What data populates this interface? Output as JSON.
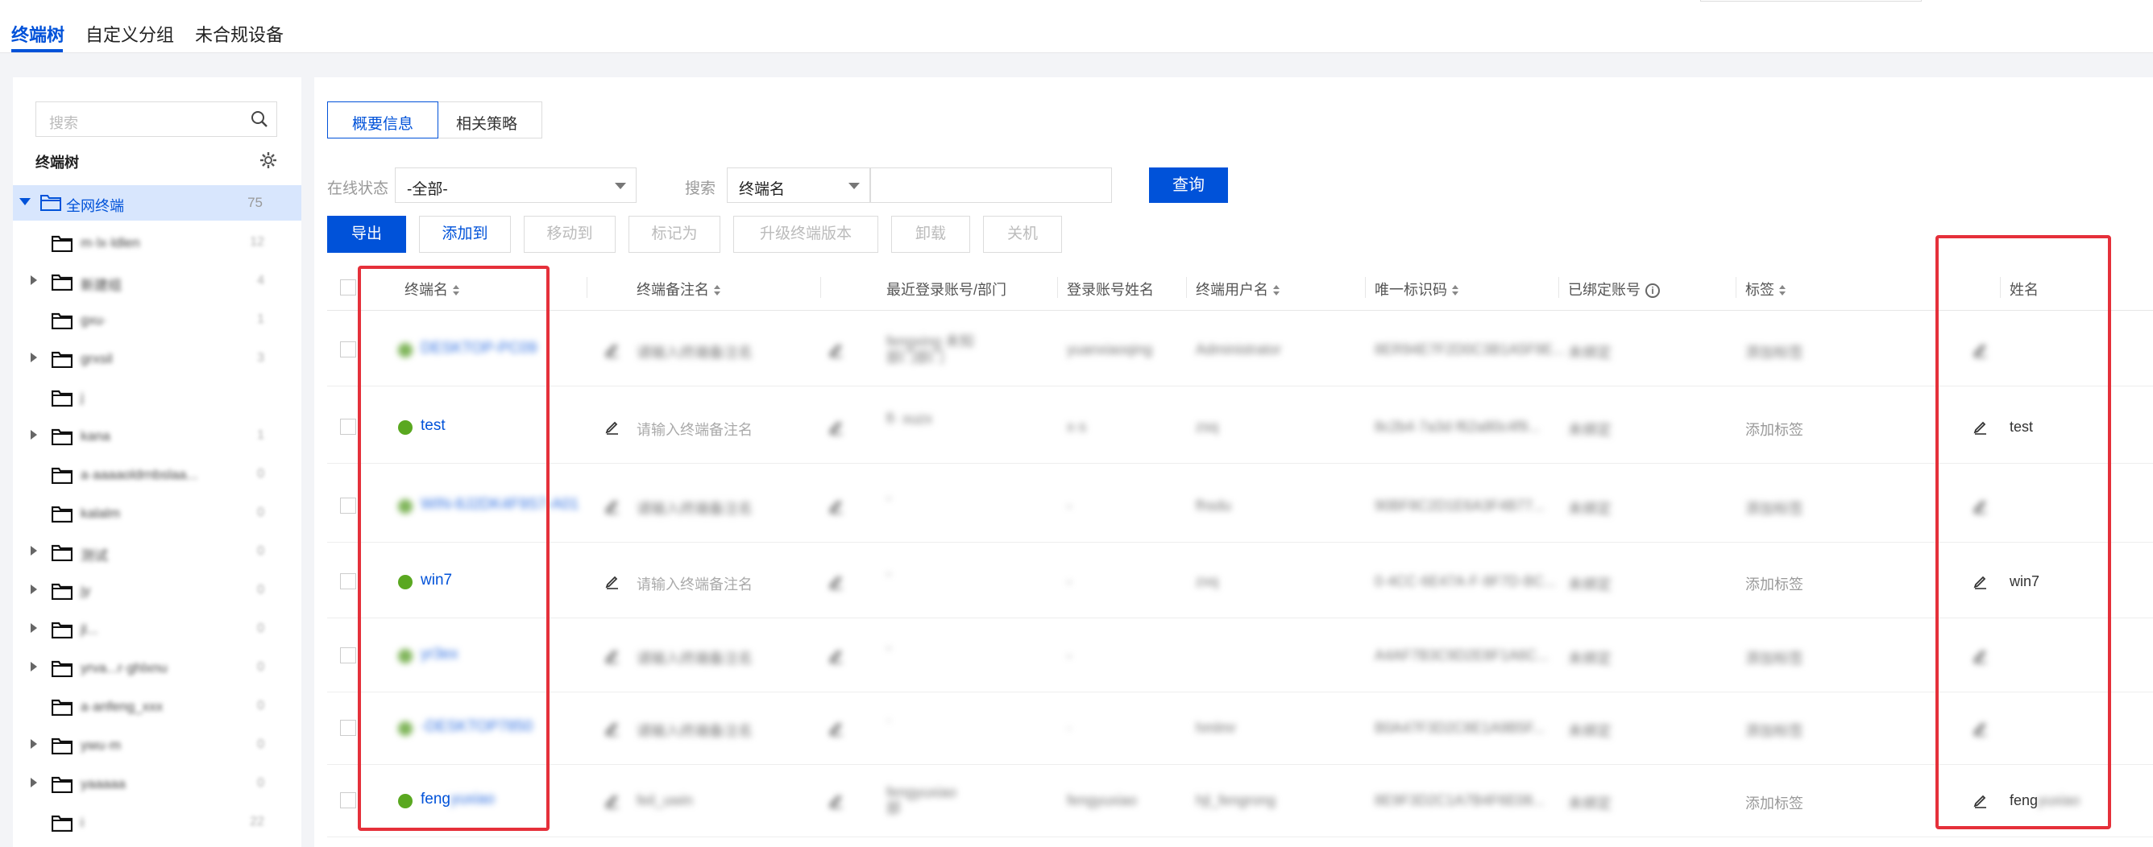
{
  "top_tabs": [
    {
      "label": "终端树",
      "active": true
    },
    {
      "label": "自定义分组",
      "active": false
    },
    {
      "label": "未合规设备",
      "active": false
    }
  ],
  "sidebar": {
    "search_placeholder": "搜索",
    "title": "终端树",
    "root": {
      "label": "全网终端",
      "count": "75"
    },
    "items": [
      {
        "label": "m·lx·ldlen",
        "count": "12",
        "expandable": false
      },
      {
        "label": "新建组",
        "count": "4",
        "expandable": true
      },
      {
        "label": "gxu·",
        "count": "1",
        "expandable": false
      },
      {
        "label": "grxsil",
        "count": "3",
        "expandable": true
      },
      {
        "label": "j",
        "count": "",
        "expandable": false
      },
      {
        "label": "kana",
        "count": "1",
        "expandable": true
      },
      {
        "label": "a·aaaaoldrnbslaa...",
        "count": "0",
        "expandable": false
      },
      {
        "label": "kalalm",
        "count": "0",
        "expandable": false
      },
      {
        "label": "测试",
        "count": "0",
        "expandable": true
      },
      {
        "label": "jy",
        "count": "0",
        "expandable": true
      },
      {
        "label": "jl...",
        "count": "0",
        "expandable": true
      },
      {
        "label": "yrva...r·ghlxnu",
        "count": "0",
        "expandable": true
      },
      {
        "label": "a·anfeng_xxx",
        "count": "0",
        "expandable": false
      },
      {
        "label": "ywu·m",
        "count": "0",
        "expandable": true
      },
      {
        "label": "yaaaaa",
        "count": "0",
        "expandable": true
      },
      {
        "label": "i",
        "count": "22",
        "expandable": false
      }
    ]
  },
  "main": {
    "subtabs": [
      {
        "label": "概要信息",
        "active": true
      },
      {
        "label": "相关策略",
        "active": false
      }
    ],
    "filter": {
      "status_label": "在线状态",
      "status_value": "-全部-",
      "search_label": "搜索",
      "search_field": "终端名",
      "search_value": "",
      "query_button": "查询"
    },
    "actions": [
      {
        "label": "导出",
        "style": "primary"
      },
      {
        "label": "添加到",
        "style": "normal"
      },
      {
        "label": "移动到",
        "style": "disabled"
      },
      {
        "label": "标记为",
        "style": "disabled"
      },
      {
        "label": "升级终端版本",
        "style": "disabled"
      },
      {
        "label": "卸载",
        "style": "disabled"
      },
      {
        "label": "关机",
        "style": "disabled"
      }
    ],
    "table": {
      "columns": [
        "终端名",
        "终端备注名",
        "最近登录账号/部门",
        "登录账号姓名",
        "终端用户名",
        "唯一标识码",
        "已绑定账号",
        "标签",
        "姓名"
      ],
      "rows": [
        {
          "name": "DESKTOP-PC09",
          "name_visible": false,
          "remark": "请输入终端备注名",
          "remark_visible": false,
          "account": "fengxing 未知部门部门",
          "account_name": "yuanxiaoqing",
          "user": "Administrator",
          "uid": "8ER94E7F2D0C3B1A5F9E...",
          "bound": "未绑定",
          "tag": "添加标签",
          "tag_visible": false,
          "full_name": "",
          "full_name_visible": false
        },
        {
          "name": "test",
          "name_visible": true,
          "remark": "请输入终端备注名",
          "remark_visible": true,
          "account": "fl· xuzx",
          "account_name": "x·s",
          "user": "zsq",
          "uid": "8c2b4·7a3d·f62a80c4f9...",
          "bound": "未绑定",
          "tag": "添加标签",
          "tag_visible": true,
          "full_name": "test",
          "full_name_visible": true
        },
        {
          "name": "WIN-8J2DK4F9S7-A01",
          "name_visible": false,
          "remark": "请输入终端备注名",
          "remark_visible": false,
          "account": "-",
          "account_name": "-",
          "user": "fhsdu",
          "uid": "90BF8C2D1E6A3F4B77...",
          "bound": "未绑定",
          "tag": "添加标签",
          "tag_visible": false,
          "full_name": "",
          "full_name_visible": false
        },
        {
          "name": "win7",
          "name_visible": true,
          "remark": "请输入终端备注名",
          "remark_visible": true,
          "account": "-",
          "account_name": "-",
          "user": "zxq",
          "uid": "0·4CC·6E47A·F·8F7D·BC...",
          "bound": "未绑定",
          "tag": "添加标签",
          "tag_visible": true,
          "full_name": "win7",
          "full_name_visible": true
        },
        {
          "name": "yr3ex",
          "name_visible": false,
          "remark": "请输入终端备注名",
          "remark_visible": false,
          "account": "-",
          "account_name": "-",
          "user": "",
          "uid": "A4AF7B3C9D2E8F1A6C...",
          "bound": "未绑定",
          "tag": "添加标签",
          "tag_visible": false,
          "full_name": "",
          "full_name_visible": false
        },
        {
          "name": "-DESKTOP7850",
          "name_visible": false,
          "remark": "请输入终端备注名",
          "remark_visible": false,
          "account": "·",
          "account_name": "·",
          "user": "hmlmr",
          "uid": "B0A47F3D2C8E1A9B5F...",
          "bound": "未绑定",
          "tag": "添加标签",
          "tag_visible": false,
          "full_name": "",
          "full_name_visible": false
        },
        {
          "name": "feng",
          "name_suffix": "yuxiao",
          "name_visible": true,
          "remark": "feil_uwin",
          "remark_visible": false,
          "account": "fengyuxiao 部",
          "account_name": "fengyuxiao",
          "user": "hjl_fengrong",
          "uid": "8E9F3D2C1A7B4F6E08...",
          "bound": "未绑定",
          "tag": "添加标签",
          "tag_visible": true,
          "full_name": "feng",
          "full_name_suffix": "yuxiao",
          "full_name_visible": true
        }
      ]
    }
  },
  "colors": {
    "primary": "#0052d9",
    "online": "#5aa820",
    "highlight": "#e5303a"
  }
}
